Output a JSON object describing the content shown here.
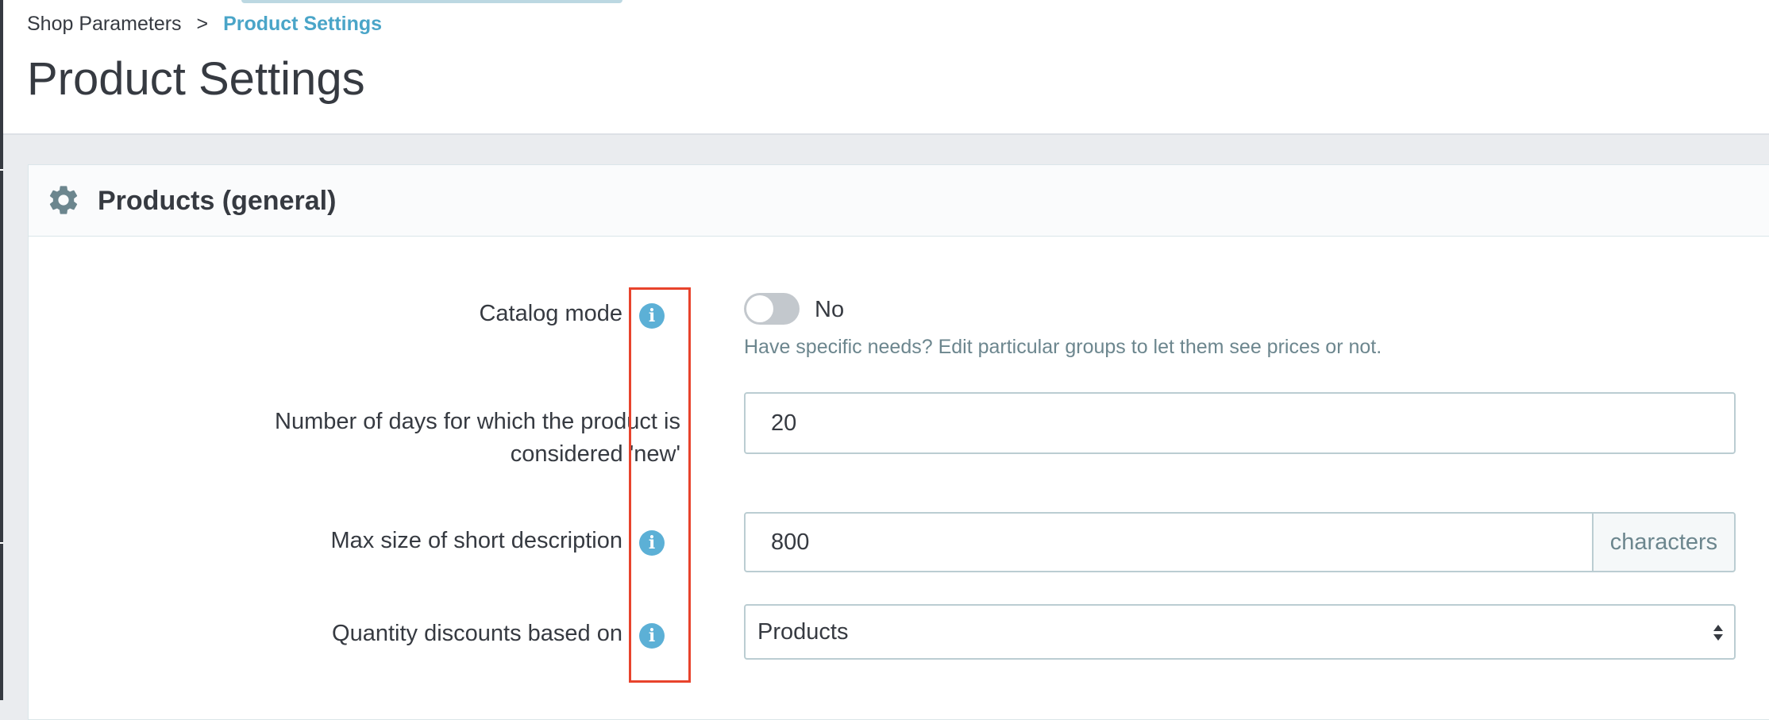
{
  "breadcrumb": {
    "parent": "Shop Parameters",
    "separator": ">",
    "current": "Product Settings"
  },
  "page": {
    "title": "Product Settings"
  },
  "panel": {
    "title": "Products (general)",
    "icon": "gear-icon"
  },
  "form": {
    "catalog_mode": {
      "label": "Catalog mode",
      "value": "No",
      "enabled": false,
      "help": "Have specific needs? Edit particular groups to let them see prices or not."
    },
    "days_new": {
      "label_line1": "Number of days for which the product is",
      "label_line2": "considered 'new'",
      "value": "20"
    },
    "short_desc_max": {
      "label": "Max size of short description",
      "value": "800",
      "addon": "characters"
    },
    "qty_discount": {
      "label": "Quantity discounts based on",
      "value": "Products"
    }
  },
  "colors": {
    "accent": "#4aa5c8",
    "info_icon": "#5cb0d6",
    "highlight": "#e8432c",
    "help_text": "#6c868e"
  }
}
